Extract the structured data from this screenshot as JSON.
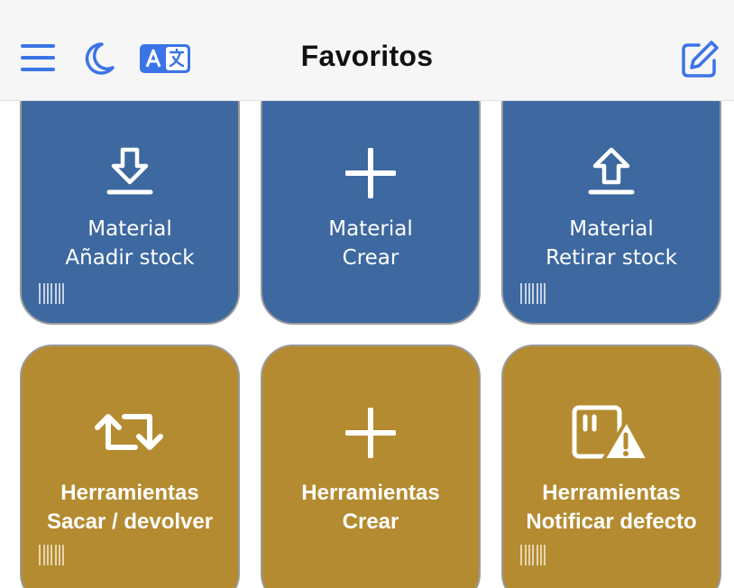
{
  "header": {
    "title": "Favoritos",
    "menu_icon": "hamburger-menu-icon",
    "theme_icon": "moon-icon",
    "language_icon": "translate-icon",
    "edit_icon": "edit-icon"
  },
  "tiles": [
    {
      "line1": "Material",
      "line2": "Añadir stock",
      "icon": "download-icon",
      "color": "#3d68a0"
    },
    {
      "line1": "Material",
      "line2": "Crear",
      "icon": "plus-icon",
      "color": "#3d68a0"
    },
    {
      "line1": "Material",
      "line2": "Retirar stock",
      "icon": "upload-icon",
      "color": "#3d68a0"
    },
    {
      "line1": "Herramientas",
      "line2": "Sacar / devolver",
      "icon": "swap-icon",
      "color": "#b48b30"
    },
    {
      "line1": "Herramientas",
      "line2": "Crear",
      "icon": "plus-icon",
      "color": "#b48b30"
    },
    {
      "line1": "Herramientas",
      "line2": "Notificar defecto",
      "icon": "defect-warning-icon",
      "color": "#b48b30"
    }
  ],
  "colors": {
    "accent": "#3b74e6",
    "material": "#3d68a0",
    "tools": "#b48b30"
  }
}
